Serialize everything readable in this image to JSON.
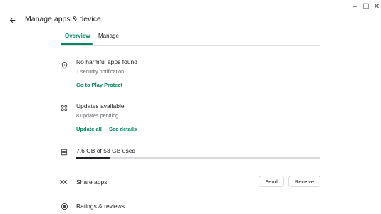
{
  "window": {
    "minimize_symbol": "–",
    "maximize_symbol": "☐",
    "close_symbol": "✕"
  },
  "header": {
    "title": "Manage apps & device",
    "back_icon": "arrow-back-icon"
  },
  "tabs": [
    {
      "label": "Overview",
      "active": true
    },
    {
      "label": "Manage",
      "active": false
    }
  ],
  "protect": {
    "icon": "shield-icon",
    "title": "No harmful apps found",
    "subtitle": "1 security notification",
    "link": "Go to Play Protect"
  },
  "updates": {
    "icon": "apps-grid-icon",
    "title": "Updates available",
    "subtitle": "8 updates pending",
    "update_all": "Update all",
    "see_details": "See details"
  },
  "storage": {
    "icon": "storage-icon",
    "text": "7.6 GB of 53 GB used",
    "used_fraction": 0.14
  },
  "share": {
    "icon": "share-apps-icon",
    "label": "Share apps",
    "send": "Send",
    "receive": "Receive"
  },
  "ratings": {
    "icon": "ratings-icon",
    "label": "Ratings & reviews"
  },
  "colors": {
    "accent": "#01875f",
    "text": "#202124",
    "muted": "#5f6368",
    "divider": "#e0e0e0"
  }
}
